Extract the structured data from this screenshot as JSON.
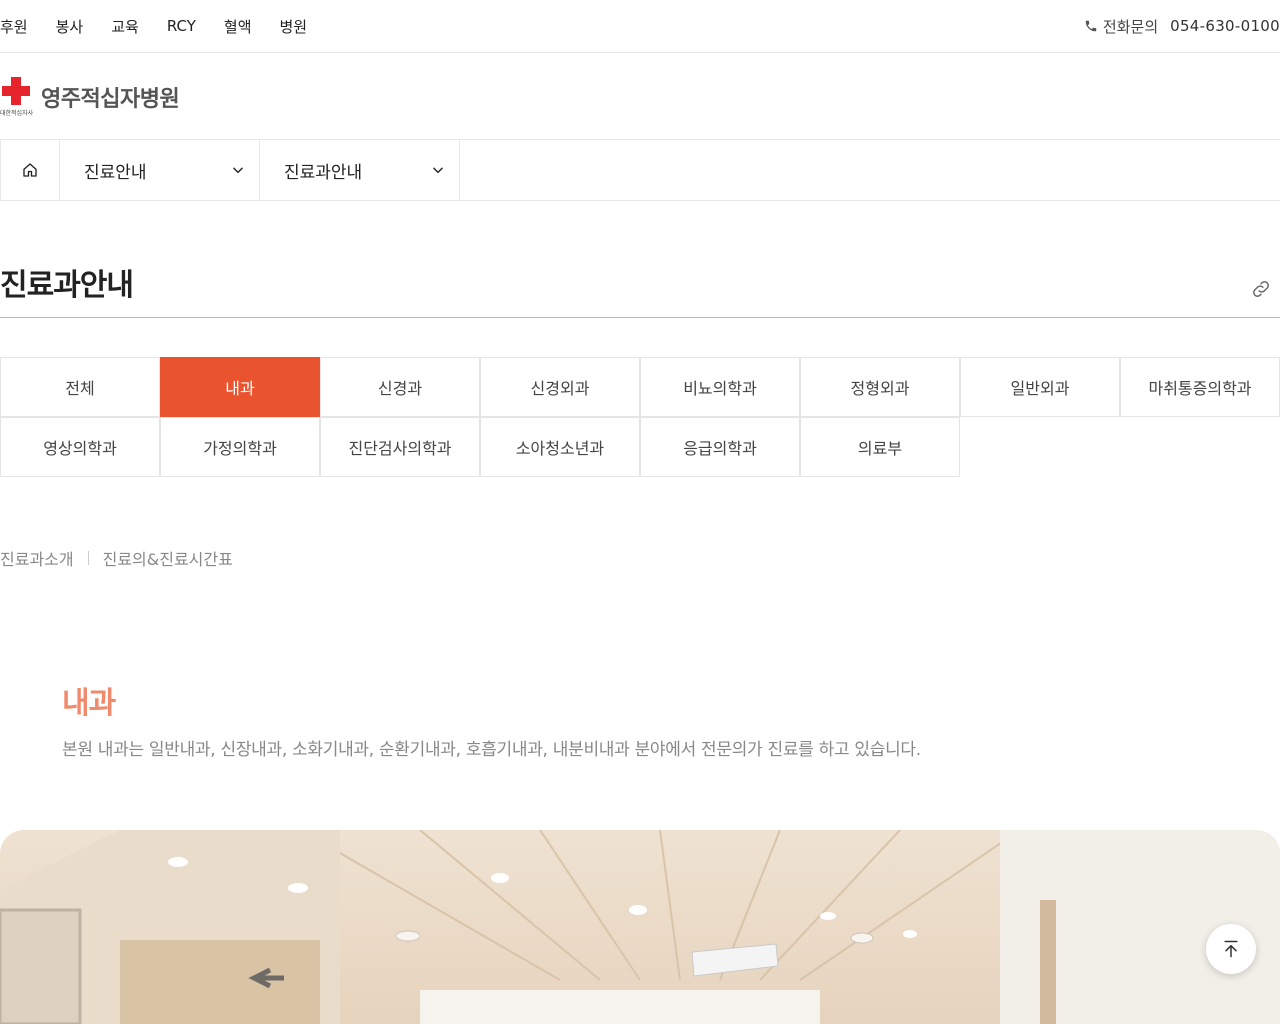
{
  "top_nav": {
    "items": [
      {
        "label": "후원"
      },
      {
        "label": "봉사"
      },
      {
        "label": "교육"
      },
      {
        "label": "RCY"
      },
      {
        "label": "혈액"
      },
      {
        "label": "병원"
      }
    ]
  },
  "contact": {
    "label": "전화문의",
    "number": "054-630-0100",
    "icon": "phone-icon"
  },
  "logo": {
    "name": "영주적십자병원",
    "sub": "대한적십자사",
    "color": "#e5242b"
  },
  "location_bar": {
    "home_icon": "home-icon",
    "level1": "진료안내",
    "level2": "진료과안내"
  },
  "page": {
    "title": "진료과안내",
    "share_icon": "link-icon"
  },
  "departments": {
    "active_index": 1,
    "accent_color": "#e9532e",
    "items": [
      {
        "label": "전체"
      },
      {
        "label": "내과"
      },
      {
        "label": "신경과"
      },
      {
        "label": "신경외과"
      },
      {
        "label": "비뇨의학과"
      },
      {
        "label": "정형외과"
      },
      {
        "label": "일반외과"
      },
      {
        "label": "마취통증의학과"
      },
      {
        "label": "영상의학과"
      },
      {
        "label": "가정의학과"
      },
      {
        "label": "진단검사의학과"
      },
      {
        "label": "소아청소년과"
      },
      {
        "label": "응급의학과"
      },
      {
        "label": "의료부"
      }
    ]
  },
  "sub_tabs": {
    "items": [
      {
        "label": "진료과소개"
      },
      {
        "label": "진료의&진료시간표"
      }
    ]
  },
  "department_intro": {
    "name": "내과",
    "description": "본원 내과는 일반내과, 신장내과, 소화기내과, 순환기내과, 호흡기내과, 내분비내과 분야에서 전문의가 진료를 하고 있습니다.",
    "name_color": "#ef8a6c"
  },
  "floating": {
    "scroll_top_icon": "arrow-up-icon"
  }
}
